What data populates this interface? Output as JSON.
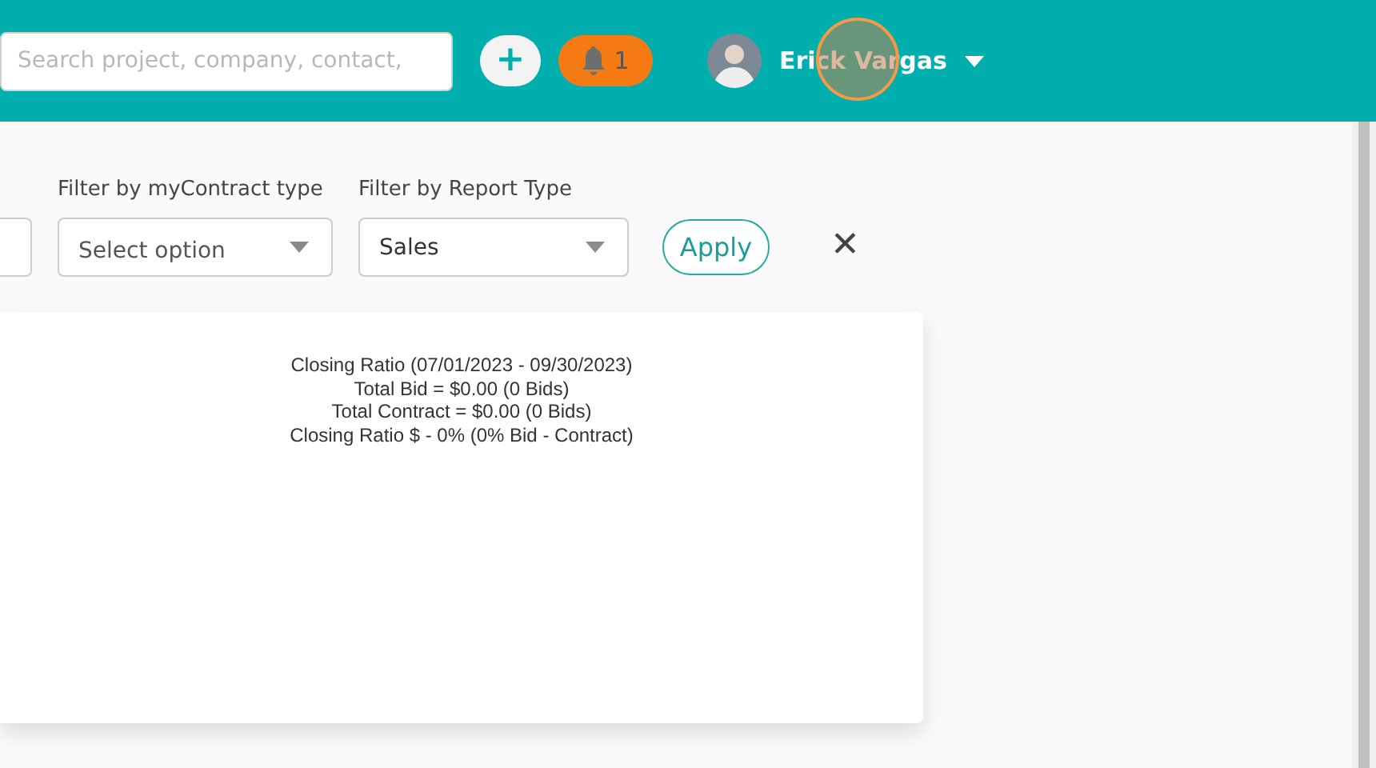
{
  "header": {
    "search": {
      "placeholder": "Search project, company, contact,"
    },
    "add_button": "+",
    "notifications": {
      "count": "1"
    },
    "user": {
      "name": "Erick Vargas"
    },
    "click_marker": true
  },
  "filters": [
    {
      "kind": "cut"
    },
    {
      "label": "Filter by myContract type",
      "placeholder": "Select option",
      "kind": "select"
    },
    {
      "label": "Filter by Report Type",
      "value": "Sales",
      "kind": "select"
    }
  ],
  "apply_button": "Apply",
  "clear_button": "✕",
  "report": {
    "lines": [
      "Closing Ratio (07/01/2023 - 09/30/2023)",
      "Total Bid = $0.00 (0 Bids)",
      "Total Contract = $0.00 (0 Bids)",
      "Closing Ratio $ - 0% (0% Bid - Contract)"
    ]
  }
}
